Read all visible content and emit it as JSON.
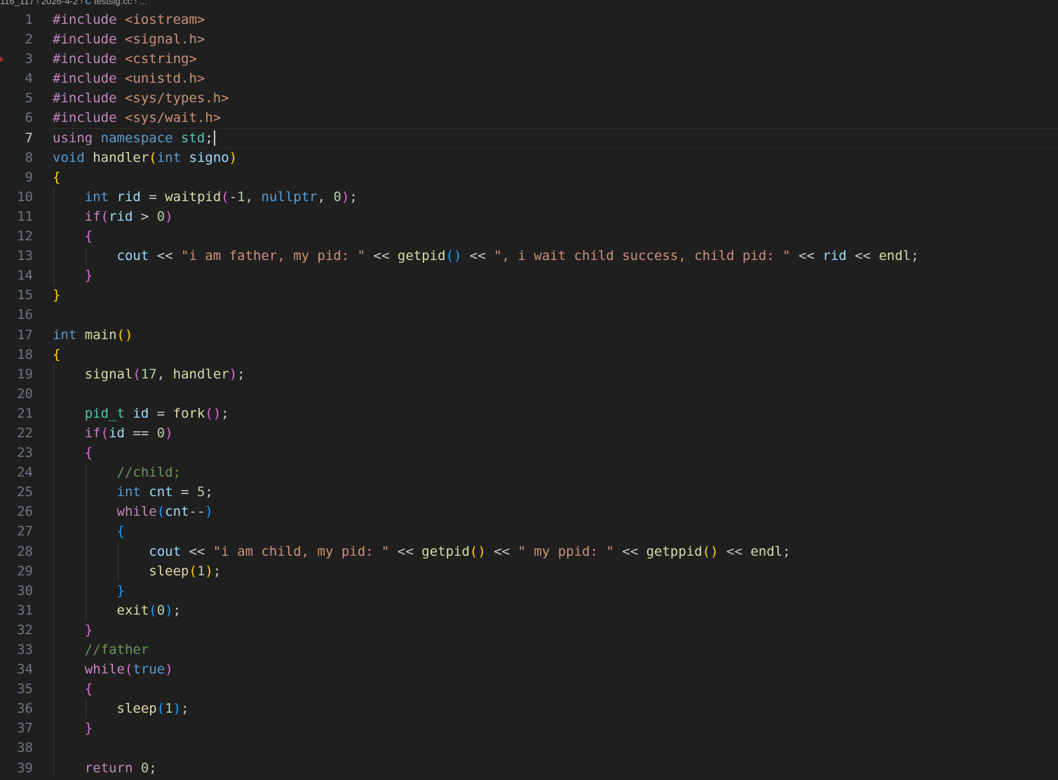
{
  "breadcrumb": [
    {
      "label": "116_117",
      "icon": null
    },
    {
      "label": "2026-4-2",
      "icon": null
    },
    {
      "label": "testsig.cc",
      "icon": "cpp-file-icon"
    },
    {
      "label": "...",
      "icon": null
    }
  ],
  "editor": {
    "current_line": 7,
    "breakpoint_line": 3,
    "lines": [
      [
        [
          "t-kw",
          "#include "
        ],
        [
          "t-inc",
          "<iostream>"
        ]
      ],
      [
        [
          "t-kw",
          "#include "
        ],
        [
          "t-inc",
          "<signal.h>"
        ]
      ],
      [
        [
          "t-kw",
          "#include "
        ],
        [
          "t-inc",
          "<cstring>"
        ]
      ],
      [
        [
          "t-kw",
          "#include "
        ],
        [
          "t-inc",
          "<unistd.h>"
        ]
      ],
      [
        [
          "t-kw",
          "#include "
        ],
        [
          "t-inc",
          "<sys/types.h>"
        ]
      ],
      [
        [
          "t-kw",
          "#include "
        ],
        [
          "t-inc",
          "<sys/wait.h>"
        ]
      ],
      [
        [
          "t-kw",
          "using "
        ],
        [
          "t-type",
          "namespace "
        ],
        [
          "t-ns",
          "std"
        ],
        [
          "t-plain",
          ";"
        ]
      ],
      [
        [
          "t-type",
          "void "
        ],
        [
          "t-fn",
          "handler"
        ],
        [
          "t-b1",
          "("
        ],
        [
          "t-type",
          "int "
        ],
        [
          "t-var",
          "signo"
        ],
        [
          "t-b1",
          ")"
        ]
      ],
      [
        [
          "t-b1",
          "{"
        ]
      ],
      [
        [
          "t-plain",
          "    "
        ],
        [
          "t-type",
          "int "
        ],
        [
          "t-var",
          "rid"
        ],
        [
          "t-plain",
          " = "
        ],
        [
          "t-fn",
          "waitpid"
        ],
        [
          "t-b2",
          "("
        ],
        [
          "t-plain",
          "-"
        ],
        [
          "t-num",
          "1"
        ],
        [
          "t-plain",
          ", "
        ],
        [
          "t-type",
          "nullptr"
        ],
        [
          "t-plain",
          ", "
        ],
        [
          "t-num",
          "0"
        ],
        [
          "t-b2",
          ")"
        ],
        [
          "t-plain",
          ";"
        ]
      ],
      [
        [
          "t-plain",
          "    "
        ],
        [
          "t-kw",
          "if"
        ],
        [
          "t-b2",
          "("
        ],
        [
          "t-var",
          "rid"
        ],
        [
          "t-plain",
          " > "
        ],
        [
          "t-num",
          "0"
        ],
        [
          "t-b2",
          ")"
        ]
      ],
      [
        [
          "t-plain",
          "    "
        ],
        [
          "t-b2",
          "{"
        ]
      ],
      [
        [
          "t-plain",
          "        "
        ],
        [
          "t-var",
          "cout"
        ],
        [
          "t-plain",
          " << "
        ],
        [
          "t-str",
          "\"i am father, my pid: \""
        ],
        [
          "t-plain",
          " << "
        ],
        [
          "t-fn",
          "getpid"
        ],
        [
          "t-b3",
          "()"
        ],
        [
          "t-plain",
          " << "
        ],
        [
          "t-str",
          "\", i wait child success, child pid: \""
        ],
        [
          "t-plain",
          " << "
        ],
        [
          "t-var",
          "rid"
        ],
        [
          "t-plain",
          " << "
        ],
        [
          "t-fn",
          "endl"
        ],
        [
          "t-plain",
          ";"
        ]
      ],
      [
        [
          "t-plain",
          "    "
        ],
        [
          "t-b2",
          "}"
        ]
      ],
      [
        [
          "t-b1",
          "}"
        ]
      ],
      [],
      [
        [
          "t-type",
          "int "
        ],
        [
          "t-fn",
          "main"
        ],
        [
          "t-b1",
          "()"
        ]
      ],
      [
        [
          "t-b1",
          "{"
        ]
      ],
      [
        [
          "t-plain",
          "    "
        ],
        [
          "t-fn",
          "signal"
        ],
        [
          "t-b2",
          "("
        ],
        [
          "t-num",
          "17"
        ],
        [
          "t-plain",
          ", "
        ],
        [
          "t-fn",
          "handler"
        ],
        [
          "t-b2",
          ")"
        ],
        [
          "t-plain",
          ";"
        ]
      ],
      [],
      [
        [
          "t-plain",
          "    "
        ],
        [
          "t-ns",
          "pid_t "
        ],
        [
          "t-var",
          "id"
        ],
        [
          "t-plain",
          " = "
        ],
        [
          "t-fn",
          "fork"
        ],
        [
          "t-b2",
          "()"
        ],
        [
          "t-plain",
          ";"
        ]
      ],
      [
        [
          "t-plain",
          "    "
        ],
        [
          "t-kw",
          "if"
        ],
        [
          "t-b2",
          "("
        ],
        [
          "t-var",
          "id"
        ],
        [
          "t-plain",
          " == "
        ],
        [
          "t-num",
          "0"
        ],
        [
          "t-b2",
          ")"
        ]
      ],
      [
        [
          "t-plain",
          "    "
        ],
        [
          "t-b2",
          "{"
        ]
      ],
      [
        [
          "t-plain",
          "        "
        ],
        [
          "t-com",
          "//child;"
        ]
      ],
      [
        [
          "t-plain",
          "        "
        ],
        [
          "t-type",
          "int "
        ],
        [
          "t-var",
          "cnt"
        ],
        [
          "t-plain",
          " = "
        ],
        [
          "t-num",
          "5"
        ],
        [
          "t-plain",
          ";"
        ]
      ],
      [
        [
          "t-plain",
          "        "
        ],
        [
          "t-kw",
          "while"
        ],
        [
          "t-b3",
          "("
        ],
        [
          "t-var",
          "cnt"
        ],
        [
          "t-plain",
          "--"
        ],
        [
          "t-b3",
          ")"
        ]
      ],
      [
        [
          "t-plain",
          "        "
        ],
        [
          "t-b3",
          "{"
        ]
      ],
      [
        [
          "t-plain",
          "            "
        ],
        [
          "t-var",
          "cout"
        ],
        [
          "t-plain",
          " << "
        ],
        [
          "t-str",
          "\"i am child, my pid: \""
        ],
        [
          "t-plain",
          " << "
        ],
        [
          "t-fn",
          "getpid"
        ],
        [
          "t-b1",
          "()"
        ],
        [
          "t-plain",
          " << "
        ],
        [
          "t-str",
          "\" my ppid: \""
        ],
        [
          "t-plain",
          " << "
        ],
        [
          "t-fn",
          "getppid"
        ],
        [
          "t-b1",
          "()"
        ],
        [
          "t-plain",
          " << "
        ],
        [
          "t-fn",
          "endl"
        ],
        [
          "t-plain",
          ";"
        ]
      ],
      [
        [
          "t-plain",
          "            "
        ],
        [
          "t-fn",
          "sleep"
        ],
        [
          "t-b1",
          "("
        ],
        [
          "t-num",
          "1"
        ],
        [
          "t-b1",
          ")"
        ],
        [
          "t-plain",
          ";"
        ]
      ],
      [
        [
          "t-plain",
          "        "
        ],
        [
          "t-b3",
          "}"
        ]
      ],
      [
        [
          "t-plain",
          "        "
        ],
        [
          "t-fn",
          "exit"
        ],
        [
          "t-b3",
          "("
        ],
        [
          "t-num",
          "0"
        ],
        [
          "t-b3",
          ")"
        ],
        [
          "t-plain",
          ";"
        ]
      ],
      [
        [
          "t-plain",
          "    "
        ],
        [
          "t-b2",
          "}"
        ]
      ],
      [
        [
          "t-plain",
          "    "
        ],
        [
          "t-com",
          "//father"
        ]
      ],
      [
        [
          "t-plain",
          "    "
        ],
        [
          "t-kw",
          "while"
        ],
        [
          "t-b2",
          "("
        ],
        [
          "t-type",
          "true"
        ],
        [
          "t-b2",
          ")"
        ]
      ],
      [
        [
          "t-plain",
          "    "
        ],
        [
          "t-b2",
          "{"
        ]
      ],
      [
        [
          "t-plain",
          "        "
        ],
        [
          "t-fn",
          "sleep"
        ],
        [
          "t-b3",
          "("
        ],
        [
          "t-num",
          "1"
        ],
        [
          "t-b3",
          ")"
        ],
        [
          "t-plain",
          ";"
        ]
      ],
      [
        [
          "t-plain",
          "    "
        ],
        [
          "t-b2",
          "}"
        ]
      ],
      [],
      [
        [
          "t-plain",
          "    "
        ],
        [
          "t-kw",
          "return "
        ],
        [
          "t-num",
          "0"
        ],
        [
          "t-plain",
          ";"
        ]
      ]
    ]
  }
}
